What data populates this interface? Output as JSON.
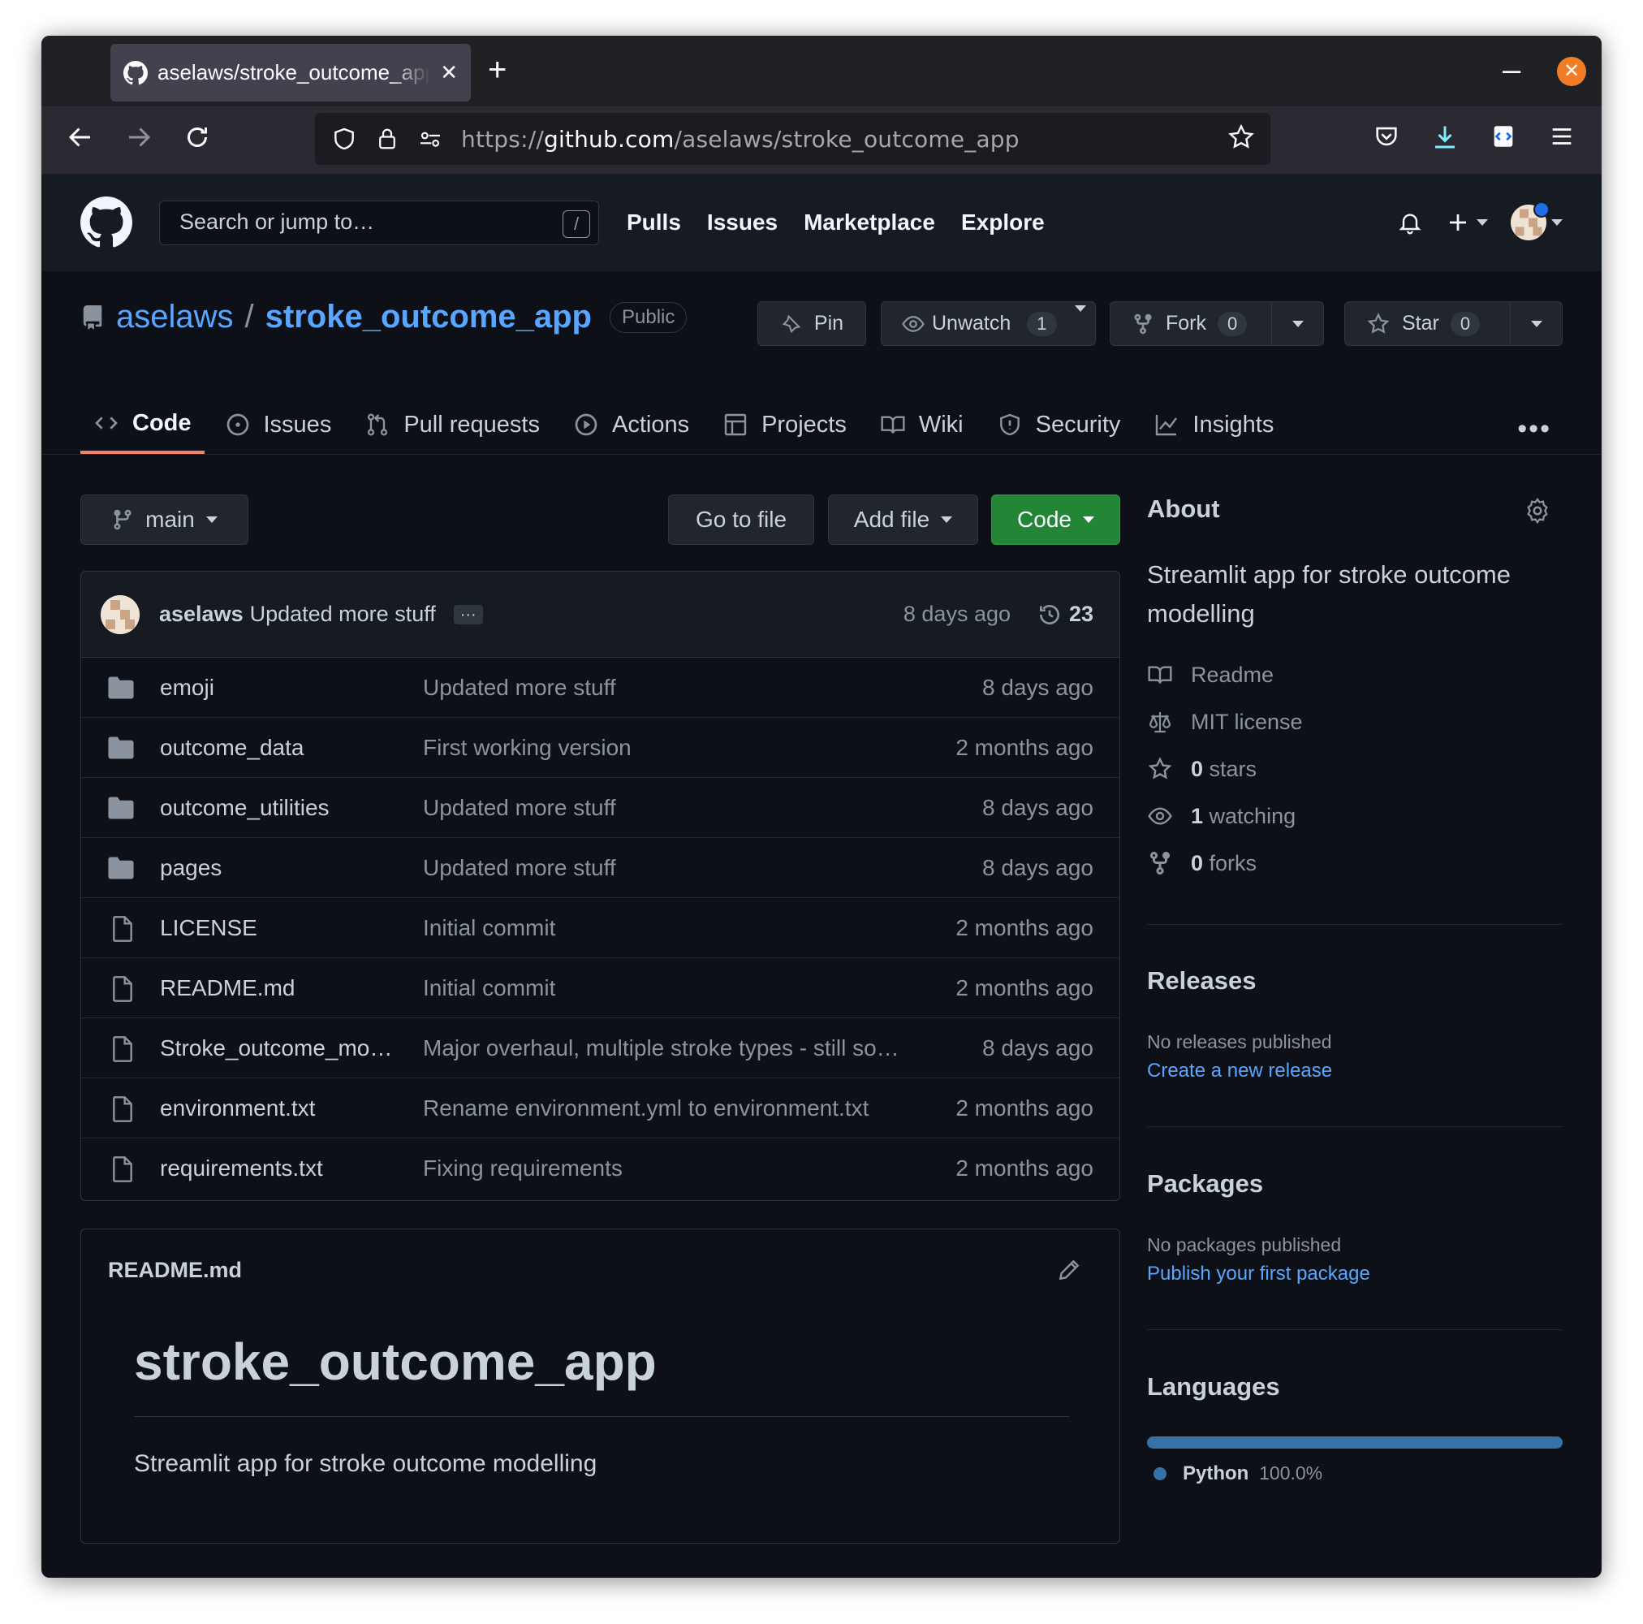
{
  "browser": {
    "tab_title": "aselaws/stroke_outcome_app",
    "url_scheme": "https://",
    "url_domain": "github.com",
    "url_path": "/aselaws/stroke_outcome_app"
  },
  "github": {
    "search_placeholder": "Search or jump to…",
    "search_shortcut": "/",
    "nav": [
      "Pulls",
      "Issues",
      "Marketplace",
      "Explore"
    ]
  },
  "repo": {
    "owner": "aselaws",
    "separator": "/",
    "name": "stroke_outcome_app",
    "visibility": "Public",
    "pin_label": "Pin",
    "unwatch_label": "Unwatch",
    "watch_count": "1",
    "fork_label": "Fork",
    "fork_count": "0",
    "star_label": "Star",
    "star_count": "0"
  },
  "tabs": [
    "Code",
    "Issues",
    "Pull requests",
    "Actions",
    "Projects",
    "Wiki",
    "Security",
    "Insights"
  ],
  "controls": {
    "branch": "main",
    "go_to_file": "Go to file",
    "add_file": "Add file",
    "code": "Code"
  },
  "latest_commit": {
    "author": "aselaws",
    "message": "Updated more stuff",
    "ellipsis": "···",
    "time": "8 days ago",
    "count": "23"
  },
  "files": [
    {
      "type": "dir",
      "name": "emoji",
      "message": "Updated more stuff",
      "time": "8 days ago"
    },
    {
      "type": "dir",
      "name": "outcome_data",
      "message": "First working version",
      "time": "2 months ago"
    },
    {
      "type": "dir",
      "name": "outcome_utilities",
      "message": "Updated more stuff",
      "time": "8 days ago"
    },
    {
      "type": "dir",
      "name": "pages",
      "message": "Updated more stuff",
      "time": "8 days ago"
    },
    {
      "type": "file",
      "name": "LICENSE",
      "message": "Initial commit",
      "time": "2 months ago"
    },
    {
      "type": "file",
      "name": "README.md",
      "message": "Initial commit",
      "time": "2 months ago"
    },
    {
      "type": "file",
      "name": "Stroke_outcome_mo…",
      "message": "Major overhaul, multiple stroke types - still so…",
      "time": "8 days ago"
    },
    {
      "type": "file",
      "name": "environment.txt",
      "message": "Rename environment.yml to environment.txt",
      "time": "2 months ago"
    },
    {
      "type": "file",
      "name": "requirements.txt",
      "message": "Fixing requirements",
      "time": "2 months ago"
    }
  ],
  "readme": {
    "filename": "README.md",
    "heading": "stroke_outcome_app",
    "body": "Streamlit app for stroke outcome modelling"
  },
  "about": {
    "title": "About",
    "description": "Streamlit app for stroke outcome modelling",
    "readme": "Readme",
    "license": "MIT license",
    "stars_count": "0",
    "stars_label": " stars",
    "watching_count": "1",
    "watching_label": " watching",
    "forks_count": "0",
    "forks_label": " forks"
  },
  "releases": {
    "title": "Releases",
    "empty": "No releases published",
    "link": "Create a new release"
  },
  "packages": {
    "title": "Packages",
    "empty": "No packages published",
    "link": "Publish your first package"
  },
  "languages": {
    "title": "Languages",
    "items": [
      {
        "name": "Python",
        "percent": "100.0%",
        "color": "#3572A5"
      }
    ]
  },
  "colors": {
    "accent_link": "#58a6ff",
    "code_button": "#238636",
    "tab_underline": "#f78166",
    "page_bg": "#0d1117"
  }
}
